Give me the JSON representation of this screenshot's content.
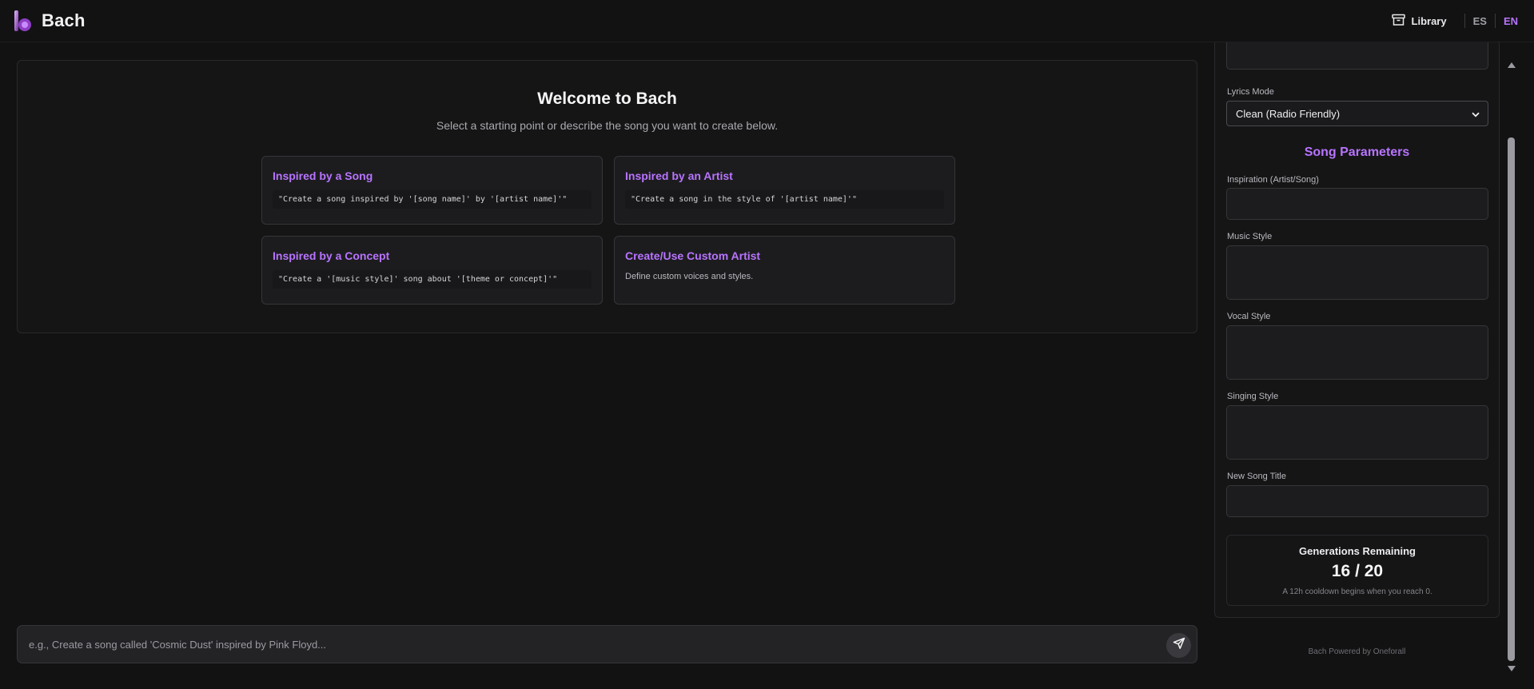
{
  "header": {
    "brand_name": "Bach",
    "library_label": "Library",
    "languages": [
      {
        "code": "ES",
        "active": false
      },
      {
        "code": "EN",
        "active": true
      }
    ]
  },
  "welcome": {
    "title": "Welcome to Bach",
    "subtitle": "Select a starting point or describe the song you want to create below.",
    "cards": [
      {
        "title": "Inspired by a Song",
        "example": "\"Create a song inspired by '[song name]' by '[artist name]'\""
      },
      {
        "title": "Inspired by an Artist",
        "example": "\"Create a song in the style of '[artist name]'\""
      },
      {
        "title": "Inspired by a Concept",
        "example": "\"Create a '[music style]' song about '[theme or concept]'\""
      },
      {
        "title": "Create/Use Custom Artist",
        "description": "Define custom voices and styles."
      }
    ]
  },
  "composer": {
    "placeholder": "e.g., Create a song called 'Cosmic Dust' inspired by Pink Floyd..."
  },
  "panel": {
    "lyrics_mode_label": "Lyrics Mode",
    "lyrics_mode_value": "Clean (Radio Friendly)",
    "section_title": "Song Parameters",
    "fields": {
      "inspiration_label": "Inspiration (Artist/Song)",
      "music_style_label": "Music Style",
      "vocal_style_label": "Vocal Style",
      "singing_style_label": "Singing Style",
      "new_song_title_label": "New Song Title"
    },
    "generations": {
      "title": "Generations Remaining",
      "count": "16 / 20",
      "note": "A 12h cooldown begins when you reach 0."
    }
  },
  "footer": "Bach Powered by Oneforall",
  "colors": {
    "accent": "#b874ff",
    "background": "#121213",
    "card": "#1c1c1e"
  }
}
